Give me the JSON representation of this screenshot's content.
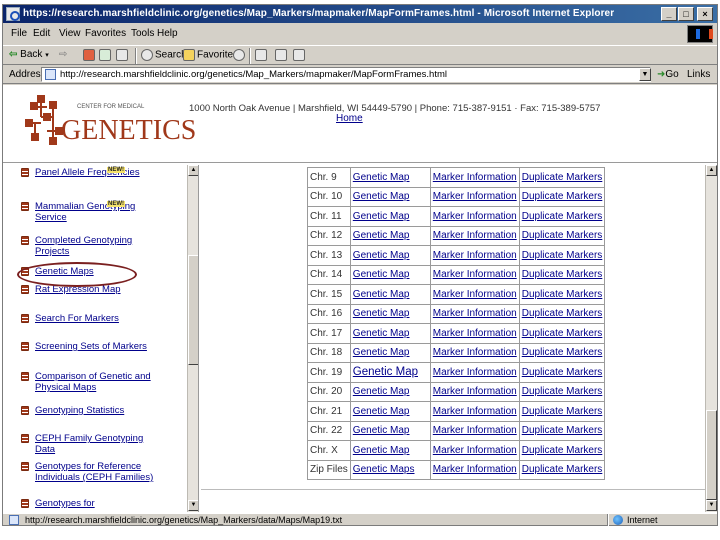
{
  "window": {
    "title": "https://research.marshfieldclinic.org/genetics/Map_Markers/mapmaker/MapFormFrames.html - Microsoft Internet Explorer",
    "controls": [
      "_",
      "□",
      "×"
    ]
  },
  "menu": [
    "File",
    "Edit",
    "View",
    "Favorites",
    "Tools",
    "Help"
  ],
  "toolbar": {
    "back": "Back",
    "search": "Search",
    "favorites": "Favorites"
  },
  "address": {
    "label": "Address",
    "url": "http://research.marshfieldclinic.org/genetics/Map_Markers/mapmaker/MapFormFrames.html",
    "go": "Go",
    "links": "Links"
  },
  "header": {
    "logo_small": "CENTER FOR MEDICAL",
    "logo_big": "GENETICS",
    "contact": "1000 North Oak Avenue | Marshfield, WI 54449-5790 | Phone: 715-387-9151 · Fax: 715-389-5757",
    "home": "Home"
  },
  "nav": {
    "new_badge": "NEW!",
    "items": [
      {
        "label": "Panel Allele Frequencies",
        "new": true
      },
      {
        "label": "Mammalian Genotyping Service",
        "new": true
      },
      {
        "label": "Completed Genotyping Projects",
        "new": false
      },
      {
        "label": "Genetic Maps",
        "new": false
      },
      {
        "label": "Rat Expression Map",
        "new": false
      },
      {
        "label": "Search For Markers",
        "new": false
      },
      {
        "label": "Screening Sets of Markers",
        "new": false
      },
      {
        "label": "Comparison of Genetic and Physical Maps",
        "new": false
      },
      {
        "label": "Genotyping Statistics",
        "new": false
      },
      {
        "label": "CEPH Family Genotyping Data",
        "new": false
      },
      {
        "label": "Genotypes for Reference Individuals (CEPH Families)",
        "new": false
      },
      {
        "label": "Genotypes for",
        "new": false
      }
    ]
  },
  "map_table": {
    "rows": [
      {
        "chr": "Chr. 9",
        "genetic": "Genetic Map",
        "marker": "Marker Information",
        "dup": "Duplicate Markers"
      },
      {
        "chr": "Chr. 10",
        "genetic": "Genetic Map",
        "marker": "Marker Information",
        "dup": "Duplicate Markers"
      },
      {
        "chr": "Chr. 11",
        "genetic": "Genetic Map",
        "marker": "Marker Information",
        "dup": "Duplicate Markers"
      },
      {
        "chr": "Chr. 12",
        "genetic": "Genetic Map",
        "marker": "Marker Information",
        "dup": "Duplicate Markers"
      },
      {
        "chr": "Chr. 13",
        "genetic": "Genetic Map",
        "marker": "Marker Information",
        "dup": "Duplicate Markers"
      },
      {
        "chr": "Chr. 14",
        "genetic": "Genetic Map",
        "marker": "Marker Information",
        "dup": "Duplicate Markers"
      },
      {
        "chr": "Chr. 15",
        "genetic": "Genetic Map",
        "marker": "Marker Information",
        "dup": "Duplicate Markers"
      },
      {
        "chr": "Chr. 16",
        "genetic": "Genetic Map",
        "marker": "Marker Information",
        "dup": "Duplicate Markers"
      },
      {
        "chr": "Chr. 17",
        "genetic": "Genetic Map",
        "marker": "Marker Information",
        "dup": "Duplicate Markers"
      },
      {
        "chr": "Chr. 18",
        "genetic": "Genetic Map",
        "marker": "Marker Information",
        "dup": "Duplicate Markers"
      },
      {
        "chr": "Chr. 19",
        "genetic": "Genetic Map",
        "marker": "Marker Information",
        "dup": "Duplicate Markers",
        "hover": true
      },
      {
        "chr": "Chr. 20",
        "genetic": "Genetic Map",
        "marker": "Marker Information",
        "dup": "Duplicate Markers"
      },
      {
        "chr": "Chr. 21",
        "genetic": "Genetic Map",
        "marker": "Marker Information",
        "dup": "Duplicate Markers"
      },
      {
        "chr": "Chr. 22",
        "genetic": "Genetic Map",
        "marker": "Marker Information",
        "dup": "Duplicate Markers"
      },
      {
        "chr": "Chr. X",
        "genetic": "Genetic Map",
        "marker": "Marker Information",
        "dup": "Duplicate Markers"
      },
      {
        "chr": "Zip Files",
        "genetic": "Genetic Maps",
        "marker": "Marker Information",
        "dup": "Duplicate Markers"
      }
    ]
  },
  "status": {
    "text": "http://research.marshfieldclinic.org/genetics/Map_Markers/data/Maps/Map19.txt",
    "zone": "Internet"
  },
  "colors": {
    "title_bar": "#0a246a",
    "link": "#00008b",
    "logo_red": "#a0381a",
    "highlight": "#7a1f1f"
  }
}
